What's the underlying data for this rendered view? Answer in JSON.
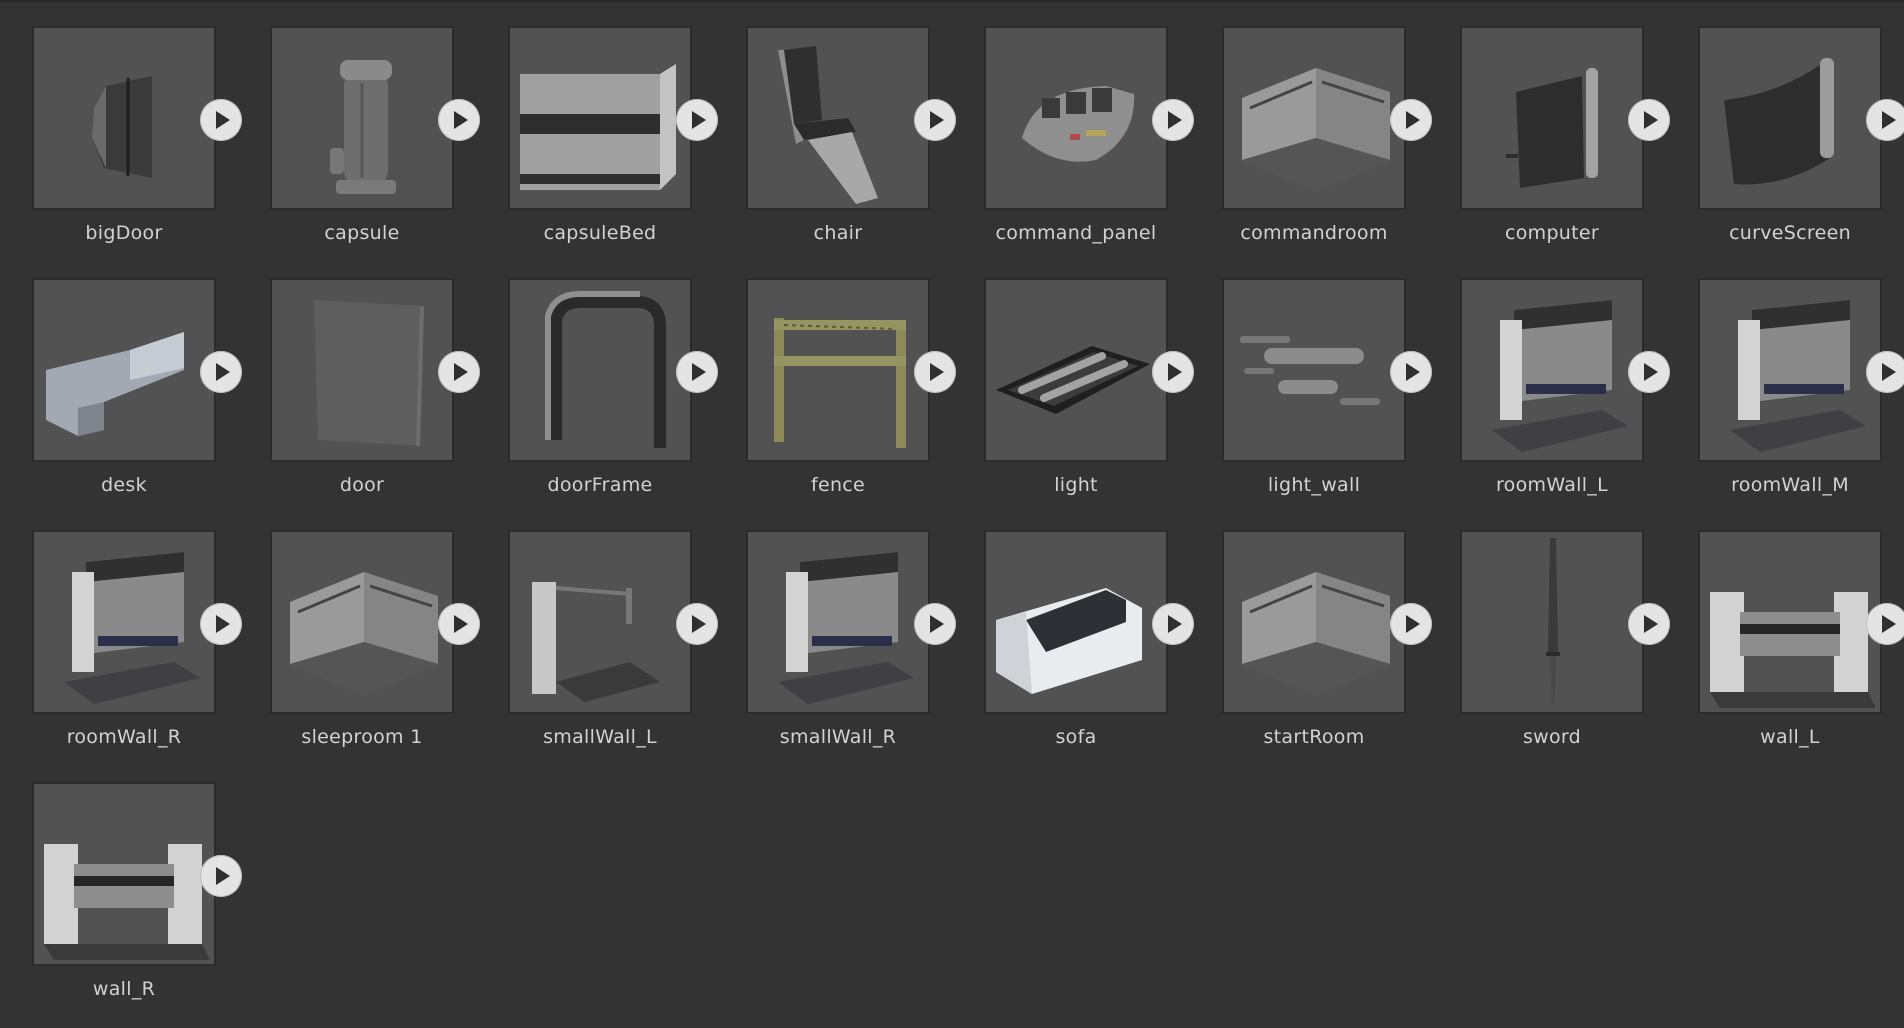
{
  "assets": [
    {
      "name": "bigDoor",
      "shape": "door-panel-icon"
    },
    {
      "name": "capsule",
      "shape": "capsule-icon"
    },
    {
      "name": "capsuleBed",
      "shape": "capsule-bed-icon"
    },
    {
      "name": "chair",
      "shape": "chair-icon"
    },
    {
      "name": "command_panel",
      "shape": "command-panel-icon"
    },
    {
      "name": "commandroom",
      "shape": "room-icon"
    },
    {
      "name": "computer",
      "shape": "screen-icon"
    },
    {
      "name": "curveScreen",
      "shape": "curve-screen-icon"
    },
    {
      "name": "desk",
      "shape": "desk-icon"
    },
    {
      "name": "door",
      "shape": "door-icon"
    },
    {
      "name": "doorFrame",
      "shape": "door-frame-icon"
    },
    {
      "name": "fence",
      "shape": "fence-icon"
    },
    {
      "name": "light",
      "shape": "light-icon"
    },
    {
      "name": "light_wall",
      "shape": "light-wall-icon"
    },
    {
      "name": "roomWall_L",
      "shape": "room-wall-icon"
    },
    {
      "name": "roomWall_M",
      "shape": "room-wall-icon"
    },
    {
      "name": "roomWall_R",
      "shape": "room-wall-icon"
    },
    {
      "name": "sleeproom 1",
      "shape": "room-icon"
    },
    {
      "name": "smallWall_L",
      "shape": "small-wall-icon"
    },
    {
      "name": "smallWall_R",
      "shape": "room-wall-icon"
    },
    {
      "name": "sofa",
      "shape": "sofa-icon"
    },
    {
      "name": "startRoom",
      "shape": "room-icon"
    },
    {
      "name": "sword",
      "shape": "sword-icon"
    },
    {
      "name": "wall_L",
      "shape": "wall-icon"
    },
    {
      "name": "wall_R",
      "shape": "wall-icon"
    }
  ]
}
